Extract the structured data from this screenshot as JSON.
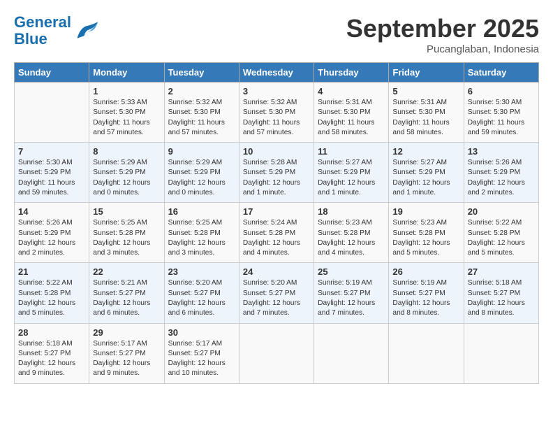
{
  "header": {
    "logo_general": "General",
    "logo_blue": "Blue",
    "month": "September 2025",
    "location": "Pucanglaban, Indonesia"
  },
  "days_of_week": [
    "Sunday",
    "Monday",
    "Tuesday",
    "Wednesday",
    "Thursday",
    "Friday",
    "Saturday"
  ],
  "weeks": [
    [
      {
        "day": "",
        "info": ""
      },
      {
        "day": "1",
        "info": "Sunrise: 5:33 AM\nSunset: 5:30 PM\nDaylight: 11 hours\nand 57 minutes."
      },
      {
        "day": "2",
        "info": "Sunrise: 5:32 AM\nSunset: 5:30 PM\nDaylight: 11 hours\nand 57 minutes."
      },
      {
        "day": "3",
        "info": "Sunrise: 5:32 AM\nSunset: 5:30 PM\nDaylight: 11 hours\nand 57 minutes."
      },
      {
        "day": "4",
        "info": "Sunrise: 5:31 AM\nSunset: 5:30 PM\nDaylight: 11 hours\nand 58 minutes."
      },
      {
        "day": "5",
        "info": "Sunrise: 5:31 AM\nSunset: 5:30 PM\nDaylight: 11 hours\nand 58 minutes."
      },
      {
        "day": "6",
        "info": "Sunrise: 5:30 AM\nSunset: 5:30 PM\nDaylight: 11 hours\nand 59 minutes."
      }
    ],
    [
      {
        "day": "7",
        "info": "Sunrise: 5:30 AM\nSunset: 5:29 PM\nDaylight: 11 hours\nand 59 minutes."
      },
      {
        "day": "8",
        "info": "Sunrise: 5:29 AM\nSunset: 5:29 PM\nDaylight: 12 hours\nand 0 minutes."
      },
      {
        "day": "9",
        "info": "Sunrise: 5:29 AM\nSunset: 5:29 PM\nDaylight: 12 hours\nand 0 minutes."
      },
      {
        "day": "10",
        "info": "Sunrise: 5:28 AM\nSunset: 5:29 PM\nDaylight: 12 hours\nand 1 minute."
      },
      {
        "day": "11",
        "info": "Sunrise: 5:27 AM\nSunset: 5:29 PM\nDaylight: 12 hours\nand 1 minute."
      },
      {
        "day": "12",
        "info": "Sunrise: 5:27 AM\nSunset: 5:29 PM\nDaylight: 12 hours\nand 1 minute."
      },
      {
        "day": "13",
        "info": "Sunrise: 5:26 AM\nSunset: 5:29 PM\nDaylight: 12 hours\nand 2 minutes."
      }
    ],
    [
      {
        "day": "14",
        "info": "Sunrise: 5:26 AM\nSunset: 5:29 PM\nDaylight: 12 hours\nand 2 minutes."
      },
      {
        "day": "15",
        "info": "Sunrise: 5:25 AM\nSunset: 5:28 PM\nDaylight: 12 hours\nand 3 minutes."
      },
      {
        "day": "16",
        "info": "Sunrise: 5:25 AM\nSunset: 5:28 PM\nDaylight: 12 hours\nand 3 minutes."
      },
      {
        "day": "17",
        "info": "Sunrise: 5:24 AM\nSunset: 5:28 PM\nDaylight: 12 hours\nand 4 minutes."
      },
      {
        "day": "18",
        "info": "Sunrise: 5:23 AM\nSunset: 5:28 PM\nDaylight: 12 hours\nand 4 minutes."
      },
      {
        "day": "19",
        "info": "Sunrise: 5:23 AM\nSunset: 5:28 PM\nDaylight: 12 hours\nand 5 minutes."
      },
      {
        "day": "20",
        "info": "Sunrise: 5:22 AM\nSunset: 5:28 PM\nDaylight: 12 hours\nand 5 minutes."
      }
    ],
    [
      {
        "day": "21",
        "info": "Sunrise: 5:22 AM\nSunset: 5:28 PM\nDaylight: 12 hours\nand 5 minutes."
      },
      {
        "day": "22",
        "info": "Sunrise: 5:21 AM\nSunset: 5:27 PM\nDaylight: 12 hours\nand 6 minutes."
      },
      {
        "day": "23",
        "info": "Sunrise: 5:20 AM\nSunset: 5:27 PM\nDaylight: 12 hours\nand 6 minutes."
      },
      {
        "day": "24",
        "info": "Sunrise: 5:20 AM\nSunset: 5:27 PM\nDaylight: 12 hours\nand 7 minutes."
      },
      {
        "day": "25",
        "info": "Sunrise: 5:19 AM\nSunset: 5:27 PM\nDaylight: 12 hours\nand 7 minutes."
      },
      {
        "day": "26",
        "info": "Sunrise: 5:19 AM\nSunset: 5:27 PM\nDaylight: 12 hours\nand 8 minutes."
      },
      {
        "day": "27",
        "info": "Sunrise: 5:18 AM\nSunset: 5:27 PM\nDaylight: 12 hours\nand 8 minutes."
      }
    ],
    [
      {
        "day": "28",
        "info": "Sunrise: 5:18 AM\nSunset: 5:27 PM\nDaylight: 12 hours\nand 9 minutes."
      },
      {
        "day": "29",
        "info": "Sunrise: 5:17 AM\nSunset: 5:27 PM\nDaylight: 12 hours\nand 9 minutes."
      },
      {
        "day": "30",
        "info": "Sunrise: 5:17 AM\nSunset: 5:27 PM\nDaylight: 12 hours\nand 10 minutes."
      },
      {
        "day": "",
        "info": ""
      },
      {
        "day": "",
        "info": ""
      },
      {
        "day": "",
        "info": ""
      },
      {
        "day": "",
        "info": ""
      }
    ]
  ]
}
